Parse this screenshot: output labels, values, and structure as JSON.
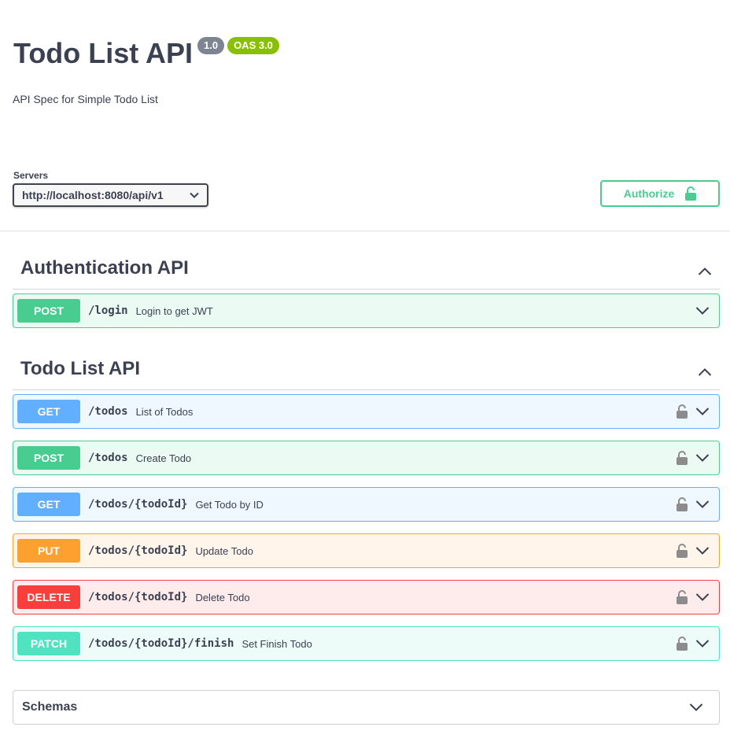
{
  "info": {
    "title": "Todo List API",
    "version": "1.0",
    "oas": "OAS 3.0",
    "description": "API Spec for Simple Todo List"
  },
  "servers": {
    "label": "Servers",
    "selected": "http://localhost:8080/api/v1"
  },
  "authorize": {
    "label": "Authorize"
  },
  "sections": [
    {
      "name": "Authentication API",
      "operations": [
        {
          "method": "POST",
          "path": "/login",
          "summary": "Login to get JWT",
          "locked": false
        }
      ]
    },
    {
      "name": "Todo List API",
      "operations": [
        {
          "method": "GET",
          "path": "/todos",
          "summary": "List of Todos",
          "locked": true
        },
        {
          "method": "POST",
          "path": "/todos",
          "summary": "Create Todo",
          "locked": true
        },
        {
          "method": "GET",
          "path": "/todos/{todoId}",
          "summary": "Get Todo by ID",
          "locked": true
        },
        {
          "method": "PUT",
          "path": "/todos/{todoId}",
          "summary": "Update Todo",
          "locked": true
        },
        {
          "method": "DELETE",
          "path": "/todos/{todoId}",
          "summary": "Delete Todo",
          "locked": true
        },
        {
          "method": "PATCH",
          "path": "/todos/{todoId}/finish",
          "summary": "Set Finish Todo",
          "locked": true
        }
      ]
    }
  ],
  "schemas": {
    "label": "Schemas"
  },
  "colors": {
    "post": "#49cc90",
    "get": "#61affe",
    "put": "#fca130",
    "delete": "#f93e3e",
    "patch": "#50e3c2"
  }
}
